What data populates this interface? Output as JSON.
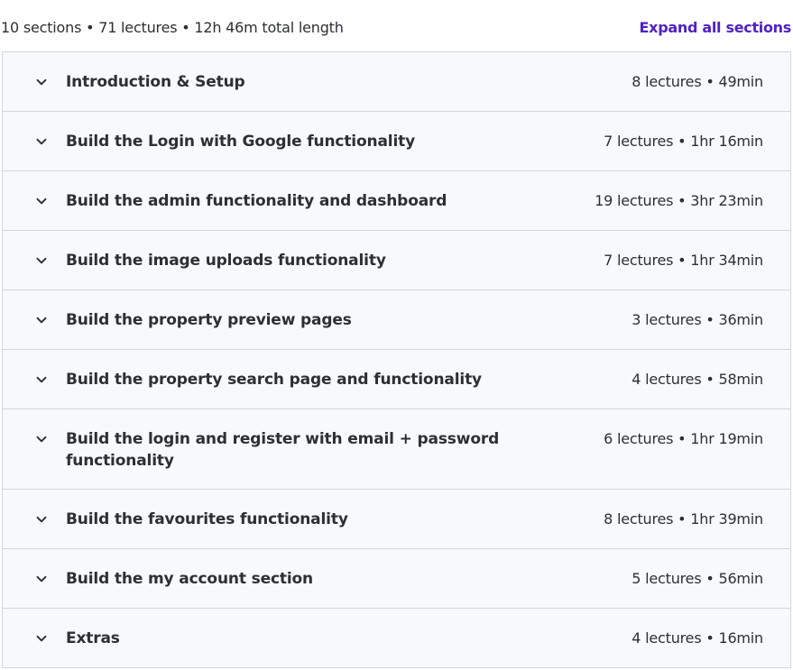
{
  "header": {
    "summary": "10 sections • 71 lectures • 12h 46m total length",
    "expand_label": "Expand all sections"
  },
  "sections": [
    {
      "title": "Introduction & Setup",
      "meta": "8 lectures • 49min"
    },
    {
      "title": "Build the Login with Google functionality",
      "meta": "7 lectures • 1hr 16min"
    },
    {
      "title": "Build the admin functionality and dashboard",
      "meta": "19 lectures • 3hr 23min"
    },
    {
      "title": "Build the image uploads functionality",
      "meta": "7 lectures • 1hr 34min"
    },
    {
      "title": "Build the property preview pages",
      "meta": "3 lectures • 36min"
    },
    {
      "title": "Build the property search page and functionality",
      "meta": "4 lectures • 58min"
    },
    {
      "title": "Build the login and register with email + password functionality",
      "meta": "6 lectures • 1hr 19min"
    },
    {
      "title": "Build the favourites functionality",
      "meta": "8 lectures • 1hr 39min"
    },
    {
      "title": "Build the my account section",
      "meta": "5 lectures • 56min"
    },
    {
      "title": "Extras",
      "meta": "4 lectures • 16min"
    }
  ],
  "icons": {
    "section_toggle": "chevron-down-icon"
  },
  "colors": {
    "accent": "#5022c3",
    "text": "#2d2f31",
    "section_bg": "#f7f9fa",
    "border": "#d1d7dc"
  }
}
